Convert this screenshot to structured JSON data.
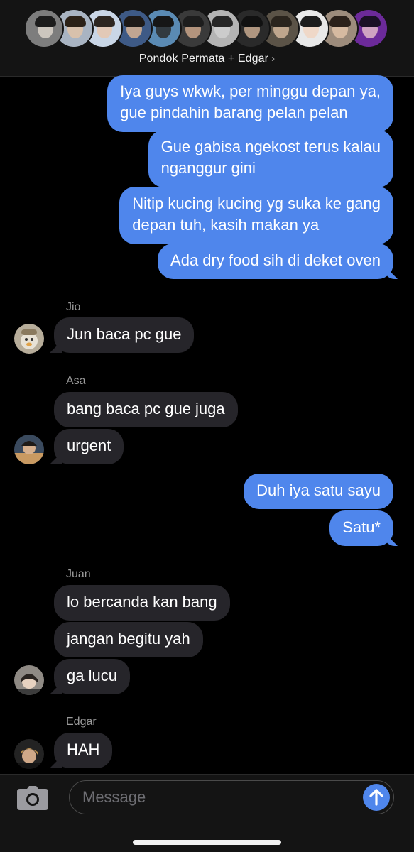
{
  "header": {
    "group_name": "Pondok Permata + Edgar",
    "chevron": "›",
    "avatars": [
      {
        "bg": "#7d7d7d",
        "hair": "#1c1c1c",
        "skin": "#d9d2c9"
      },
      {
        "bg": "#a9b4c2",
        "hair": "#2b2117",
        "skin": "#e0c3a8"
      },
      {
        "bg": "#c9d6e6",
        "hair": "#2d2620",
        "skin": "#e6c7ae"
      },
      {
        "bg": "#3e5a86",
        "hair": "#1e1a18",
        "skin": "#d7b394"
      },
      {
        "bg": "#5a8ab3",
        "hair": "#161616",
        "skin": "#2b2b2b"
      },
      {
        "bg": "#3a3a3a",
        "hair": "#1d1d1d",
        "skin": "#c9a58a"
      },
      {
        "bg": "#b4b4b4",
        "hair": "#262626",
        "skin": "#d0d0d0"
      },
      {
        "bg": "#2a2a2a",
        "hair": "#111111",
        "skin": "#c7a98f"
      },
      {
        "bg": "#5b5347",
        "hair": "#2a241d",
        "skin": "#d1b59a"
      },
      {
        "bg": "#e8e8e8",
        "hair": "#1c1c1c",
        "skin": "#f0d5c2"
      },
      {
        "bg": "#9d8c7c",
        "hair": "#2b211a",
        "skin": "#e0c2a8"
      },
      {
        "bg": "#6c2a9a",
        "hair": "#1a1026",
        "skin": "#e0b9c9"
      }
    ]
  },
  "messages": {
    "m1": "Iya guys wkwk, per minggu depan ya,\ngue pindahin barang pelan pelan",
    "m2": "Gue gabisa ngekost terus kalau\nnganggur gini",
    "m3": "Nitip kucing kucing yg suka ke gang\ndepan tuh, kasih makan ya",
    "m4": "Ada dry food sih di deket oven",
    "jio_name": "Jio",
    "jio_1": "Jun baca pc gue",
    "asa_name": "Asa",
    "asa_1": "bang baca pc gue juga",
    "asa_2": "urgent",
    "m5": "Duh iya satu sayu",
    "m6": "Satu*",
    "juan_name": "Juan",
    "juan_1": "lo bercanda kan bang",
    "juan_2": "jangan begitu yah",
    "juan_3": "ga lucu",
    "edgar_name": "Edgar",
    "edgar_1": "HAH"
  },
  "composer": {
    "placeholder": "Message",
    "camera_icon": "camera-icon",
    "send_icon": "arrow-up-icon"
  },
  "colors": {
    "outgoing": "#4f86ec",
    "incoming": "#26252a",
    "background": "#000000"
  }
}
